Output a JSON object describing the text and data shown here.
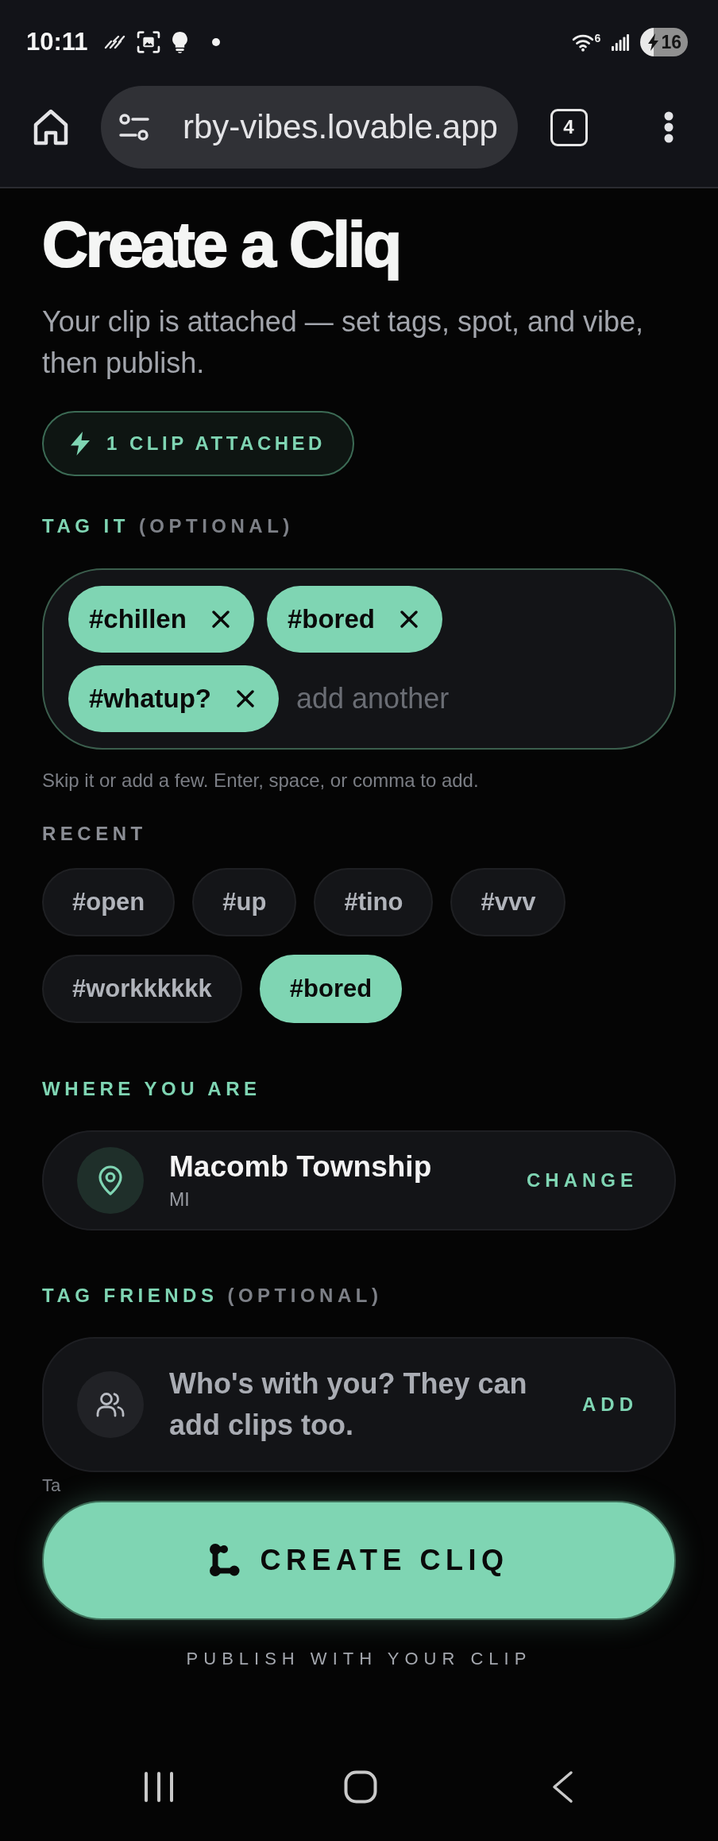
{
  "status_bar": {
    "time": "10:11",
    "network_type": "6",
    "battery": "16"
  },
  "browser": {
    "url": "rby-vibes.lovable.app",
    "tab_count": "4"
  },
  "page": {
    "title": "Create a Cliq",
    "subtitle": "Your clip is attached — set tags, spot, and vibe, then publish.",
    "attachment": "1 CLIP ATTACHED"
  },
  "tags": {
    "label": "TAG IT",
    "label_note": "(OPTIONAL)",
    "chips": [
      {
        "label": "#chillen"
      },
      {
        "label": "#bored"
      },
      {
        "label": "#whatup?"
      }
    ],
    "input": {
      "placeholder": "add another"
    },
    "hint": "Skip it or add a few. Enter, space, or comma to add."
  },
  "recent": {
    "label": "RECENT",
    "chips": [
      {
        "label": "#open",
        "selected": false
      },
      {
        "label": "#up",
        "selected": false
      },
      {
        "label": "#tino",
        "selected": false
      },
      {
        "label": "#vvv",
        "selected": false
      },
      {
        "label": "#workkkkkk",
        "selected": false
      },
      {
        "label": "#bored",
        "selected": true
      }
    ]
  },
  "location": {
    "label": "WHERE YOU ARE",
    "city": "Macomb Township",
    "region": "MI",
    "action": "CHANGE"
  },
  "friends": {
    "label": "TAG FRIENDS",
    "label_note": "(OPTIONAL)",
    "prompt": "Who's with you? They can add clips too.",
    "action": "ADD",
    "hint": "Ta"
  },
  "publish": {
    "button": "CREATE CLIQ",
    "caption": "PUBLISH WITH YOUR CLIP"
  }
}
